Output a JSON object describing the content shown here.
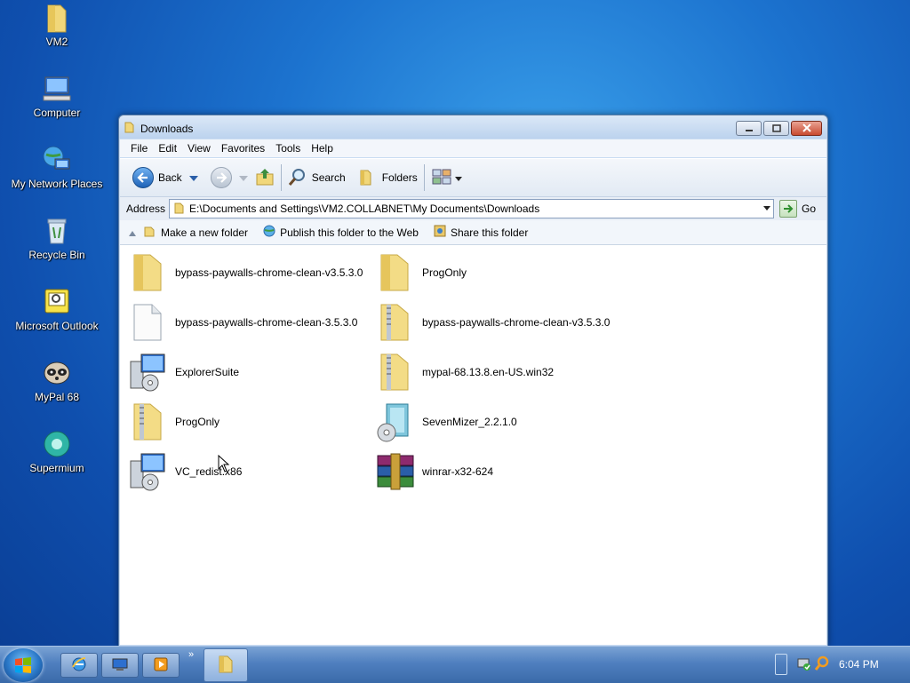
{
  "desktop": {
    "icons": [
      {
        "label": "VM2",
        "icon": "folder-icon"
      },
      {
        "label": "Computer",
        "icon": "computer-icon"
      },
      {
        "label": "My Network Places",
        "icon": "network-icon"
      },
      {
        "label": "Recycle Bin",
        "icon": "recycle-bin-icon"
      },
      {
        "label": "Microsoft Outlook",
        "icon": "outlook-icon"
      },
      {
        "label": "MyPal 68",
        "icon": "mypal-icon"
      },
      {
        "label": "Supermium",
        "icon": "supermium-icon"
      }
    ]
  },
  "window": {
    "title": "Downloads",
    "menu": [
      "File",
      "Edit",
      "View",
      "Favorites",
      "Tools",
      "Help"
    ],
    "toolbar": {
      "back": "Back",
      "search": "Search",
      "folders": "Folders"
    },
    "address": {
      "label": "Address",
      "path": "E:\\Documents and Settings\\VM2.COLLABNET\\My Documents\\Downloads",
      "go": "Go"
    },
    "tasks": [
      "Make a new folder",
      "Publish this folder to the Web",
      "Share this folder"
    ],
    "files": [
      {
        "name": "bypass-paywalls-chrome-clean-v3.5.3.0",
        "icon": "folder-icon"
      },
      {
        "name": "ProgOnly",
        "icon": "folder-icon"
      },
      {
        "name": "bypass-paywalls-chrome-clean-3.5.3.0",
        "icon": "blank-file-icon"
      },
      {
        "name": "bypass-paywalls-chrome-clean-v3.5.3.0",
        "icon": "zip-folder-icon"
      },
      {
        "name": "ExplorerSuite",
        "icon": "installer-icon"
      },
      {
        "name": "mypal-68.13.8.en-US.win32",
        "icon": "zip-folder-icon"
      },
      {
        "name": "ProgOnly",
        "icon": "zip-folder-icon"
      },
      {
        "name": "SevenMizer_2.2.1.0",
        "icon": "disc-installer-icon"
      },
      {
        "name": "VC_redist.x86",
        "icon": "installer-icon"
      },
      {
        "name": "winrar-x32-624",
        "icon": "winrar-icon"
      }
    ]
  },
  "taskbar": {
    "clock": "6:04 PM",
    "quick_launch": [
      "internet-explorer-icon",
      "show-desktop-icon",
      "media-player-icon"
    ],
    "chevron": "»"
  }
}
